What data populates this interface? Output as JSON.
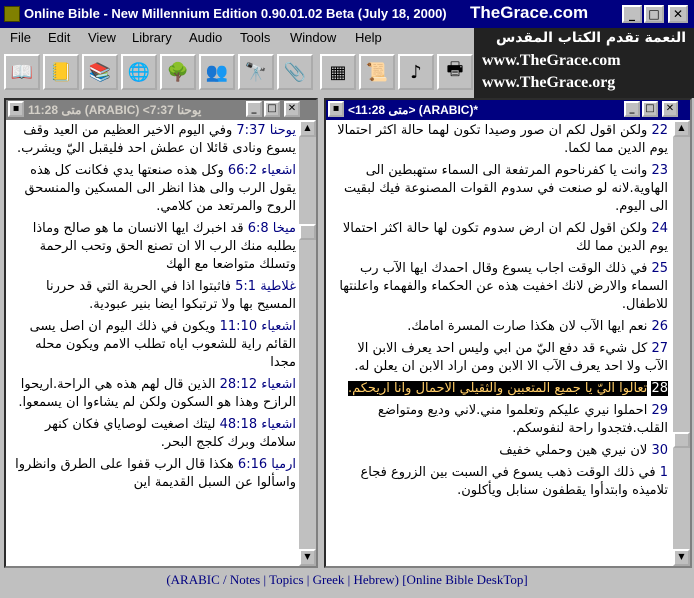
{
  "window": {
    "title": "Online Bible - New Millennium Edition 0.90.01.02 Beta (July 18, 2000)",
    "brand": "TheGrace.com"
  },
  "banner": {
    "arabic": "النعمة تقدم الكتاب المقدس",
    "url1": "www.TheGrace.com",
    "url2": "www.TheGrace.org"
  },
  "menu": [
    "File",
    "Edit",
    "View",
    "Library",
    "Audio",
    "Tools",
    "Window",
    "Help"
  ],
  "toolbar": [
    {
      "name": "open-book-icon",
      "glyph": "📖"
    },
    {
      "name": "notebook-icon",
      "glyph": "📒"
    },
    {
      "name": "library-icon",
      "glyph": "📚"
    },
    {
      "name": "globe-icon",
      "glyph": "🌐"
    },
    {
      "name": "tree-icon",
      "glyph": "🌳"
    },
    {
      "name": "people-icon",
      "glyph": "👥"
    },
    {
      "name": "binoculars-icon",
      "glyph": "🔭"
    },
    {
      "name": "paperclip-icon",
      "glyph": "📎"
    },
    {
      "name": "columns-icon",
      "glyph": "▦"
    },
    {
      "name": "scroll-icon",
      "glyph": "📜"
    },
    {
      "name": "audio-icon",
      "glyph": "♪"
    },
    {
      "name": "printer-icon",
      "glyph": "🖶"
    }
  ],
  "left_pane": {
    "title": "متى 11:28 (ARABIC) <يوحنا 7:37",
    "verses": [
      {
        "ref": "يوحنا 7:37",
        "text": "وفي اليوم الاخير العظيم من العيد وقف يسوع ونادى قائلا ان عطش احد فليقبل اليّ ويشرب."
      },
      {
        "ref": "اشعياء 66:2",
        "text": "وكل هذه صنعتها يدي فكانت كل هذه يقول الرب والى هذا انظر الى المسكين والمنسحق الروح والمرتعد من كلامي."
      },
      {
        "ref": "ميخا 6:8",
        "text": "قد اخبرك ايها الانسان ما هو صالح وماذا يطلبه منك الرب الا ان تصنع الحق وتحب الرحمة وتسلك متواضعا مع الهك"
      },
      {
        "ref": "غلاطية 5:1",
        "text": "فاثبتوا اذا في الحرية التي قد حررنا المسيح بها ولا ترتبكوا ايضا بنير عبودية."
      },
      {
        "ref": "اشعياء 11:10",
        "text": "ويكون في ذلك اليوم ان اصل يسى القائم راية للشعوب اياه تطلب الامم ويكون محله مجدا"
      },
      {
        "ref": "اشعياء 28:12",
        "text": "الذين قال لهم هذه هي الراحة.اريحوا الرازح وهذا هو السكون ولكن لم يشاءوا ان يسمعوا."
      },
      {
        "ref": "اشعياء 48:18",
        "text": "ليتك اصغيت لوصاياي فكان كنهر سلامك وبرك كلجج البحر."
      },
      {
        "ref": "ارميا 6:16",
        "text": "هكذا قال الرب قفوا على الطرق وانظروا واسألوا عن السبل القديمة اين"
      }
    ]
  },
  "right_pane": {
    "title": "<متى 11:28> (ARABIC)*",
    "verses": [
      {
        "ref": "22",
        "text": "ولكن اقول لكم ان صور وصيدا تكون لهما حالة اكثر احتمالا يوم الدين مما لكما."
      },
      {
        "ref": "23",
        "text": "وانت يا كفرناحوم المرتفعة الى السماء ستهبطين الى الهاوية.لانه لو صنعت في سدوم القوات المصنوعة فيك لبقيت الى اليوم."
      },
      {
        "ref": "24",
        "text": "ولكن اقول لكم ان ارض سدوم تكون لها حالة اكثر احتمالا يوم الدين مما لك"
      },
      {
        "ref": "25",
        "text": "في ذلك الوقت اجاب يسوع وقال احمدك ايها الآب رب السماء والارض لانك اخفيت هذه عن الحكماء والفهماء واعلنتها للاطفال."
      },
      {
        "ref": "26",
        "text": "نعم ايها الآب لان هكذا صارت المسرة امامك."
      },
      {
        "ref": "27",
        "text": "كل شيء قد دفع اليّ من ابي وليس احد يعرف الابن الا الآب ولا احد يعرف الآب الا الابن ومن اراد الابن ان يعلن له."
      },
      {
        "ref": "28",
        "text": "تعالوا اليّ يا جميع المتعبين والثقيلي الاحمال وانا اريحكم."
      },
      {
        "ref": "29",
        "text": "احملوا نيري عليكم وتعلموا مني.لاني وديع ومتواضع القلب.فتجدوا راحة لنفوسكم."
      },
      {
        "ref": "30",
        "text": "لان نيري هين وحملي خفيف"
      },
      {
        "ref": "1",
        "text": "في ذلك الوقت ذهب يسوع في السبت بين الزروع فجاع تلاميذه وابتدأوا يقطفون سنابل ويأكلون."
      }
    ],
    "highlighted_ref": "28"
  },
  "statusbar": "(ARABIC / Notes | Topics | Greek | Hebrew)     [Online Bible DeskTop]"
}
